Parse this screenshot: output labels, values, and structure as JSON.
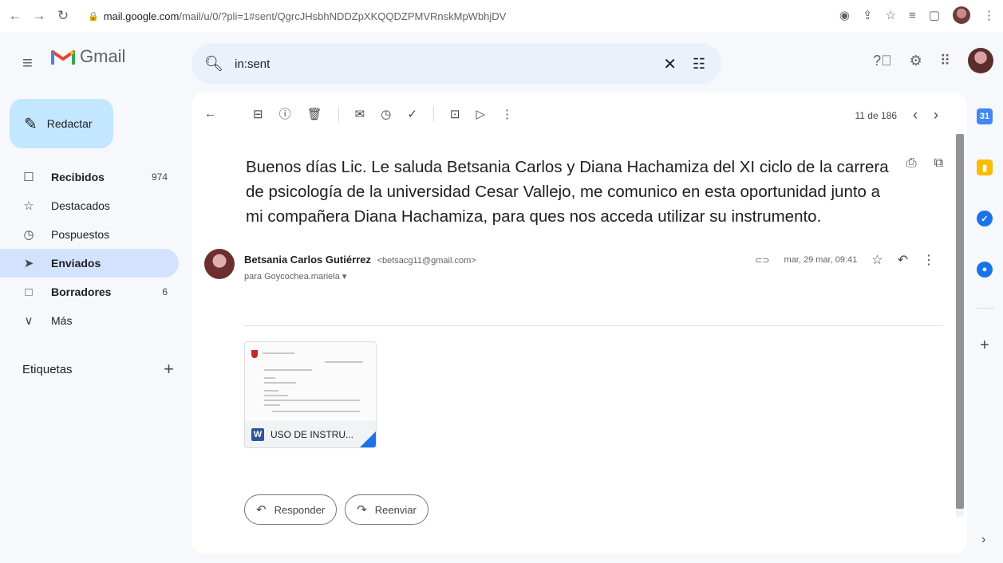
{
  "browser": {
    "url_host": "mail.google.com",
    "url_path": "/mail/u/0/?pli=1#sent/QgrcJHsbhNDDZpXKQQDZPMVRnskMpWbhjDV",
    "icons": [
      "back-icon",
      "forward-icon",
      "reload-icon",
      "lock-icon",
      "location-icon",
      "share-icon",
      "bookmark-star-icon",
      "reading-list-icon",
      "split-view-icon",
      "profile-avatar",
      "menu-icon"
    ]
  },
  "app": {
    "name": "Gmail",
    "search_query": "in:sent"
  },
  "sidebar": {
    "compose_label": "Redactar",
    "items": [
      {
        "label": "Recibidos",
        "count": "974",
        "icon": "inbox-icon",
        "glyph": "☐"
      },
      {
        "label": "Destacados",
        "count": "",
        "icon": "star-icon",
        "glyph": "☆"
      },
      {
        "label": "Pospuestos",
        "count": "",
        "icon": "clock-icon",
        "glyph": "◷"
      },
      {
        "label": "Enviados",
        "count": "",
        "icon": "send-icon",
        "glyph": "➤"
      },
      {
        "label": "Borradores",
        "count": "6",
        "icon": "draft-icon",
        "glyph": "□"
      },
      {
        "label": "Más",
        "count": "",
        "icon": "expand-more-icon",
        "glyph": "∨"
      }
    ],
    "labels_heading": "Etiquetas"
  },
  "toolbar": {
    "pager": "11 de 186"
  },
  "message": {
    "subject": "Buenos días Lic. Le saluda Betsania Carlos y Diana Hachamiza del XI ciclo de la carrera de psicología de la universidad Cesar Vallejo, me comunico en esta oportunidad junto a mi compañera Diana Hachamiza, para ques nos acceda utilizar su instrumento.",
    "sender_name": "Betsania Carlos Gutiérrez",
    "sender_email": "<betsacg11@gmail.com>",
    "to": "para Goycochea.mariela",
    "date": "mar, 29 mar, 09:41",
    "attachment_name": "USO DE INSTRU...",
    "reply_label": "Responder",
    "forward_label": "Reenviar"
  },
  "colors": {
    "compose_bg": "#c2e7ff",
    "active_item_bg": "#d3e3fd",
    "search_bg": "#eaf1fb",
    "word_blue": "#2b579a"
  }
}
